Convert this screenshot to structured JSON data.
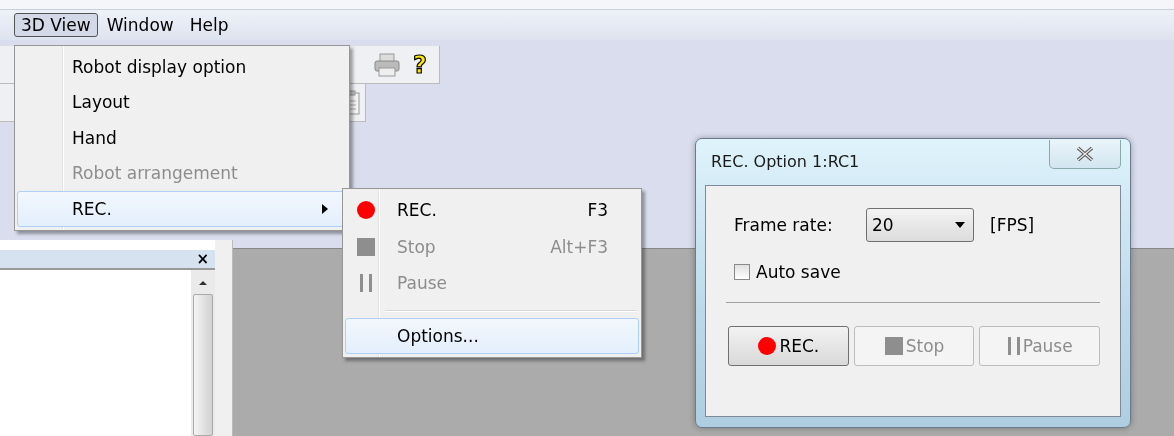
{
  "menubar": [
    {
      "label": "3D View",
      "selected": true
    },
    {
      "label": "Window",
      "selected": false
    },
    {
      "label": "Help",
      "selected": false
    }
  ],
  "toolbar": {
    "help_glyph": "?"
  },
  "menu": [
    {
      "label": "Robot display option",
      "disabled": false,
      "selected": false,
      "submenu": false
    },
    {
      "label": "Layout",
      "disabled": false,
      "selected": false,
      "submenu": false
    },
    {
      "label": "Hand",
      "disabled": false,
      "selected": false,
      "submenu": false
    },
    {
      "label": "Robot arrangement",
      "disabled": true,
      "selected": false,
      "submenu": false
    },
    {
      "label": "REC.",
      "disabled": false,
      "selected": true,
      "submenu": true
    }
  ],
  "submenu": [
    {
      "kind": "item",
      "label": "REC.",
      "shortcut": "F3",
      "disabled": false,
      "selected": false
    },
    {
      "kind": "item",
      "label": "Stop",
      "shortcut": "Alt+F3",
      "disabled": true,
      "selected": false
    },
    {
      "kind": "item",
      "label": "Pause",
      "disabled": true,
      "selected": false
    },
    {
      "kind": "separator"
    },
    {
      "kind": "item",
      "label": "Options...",
      "disabled": false,
      "selected": true
    }
  ],
  "side_panel": {
    "close_glyph": "×"
  },
  "dialog": {
    "title": "REC. Option 1:RC1",
    "frame_rate_label": "Frame rate:",
    "frame_rate": "20",
    "unit": "[FPS]",
    "auto_save": {
      "label": "Auto save",
      "checked": false
    },
    "buttons": [
      {
        "label": "REC.",
        "disabled": false
      },
      {
        "label": "Stop",
        "disabled": true
      },
      {
        "label": "Pause",
        "disabled": true
      }
    ]
  }
}
